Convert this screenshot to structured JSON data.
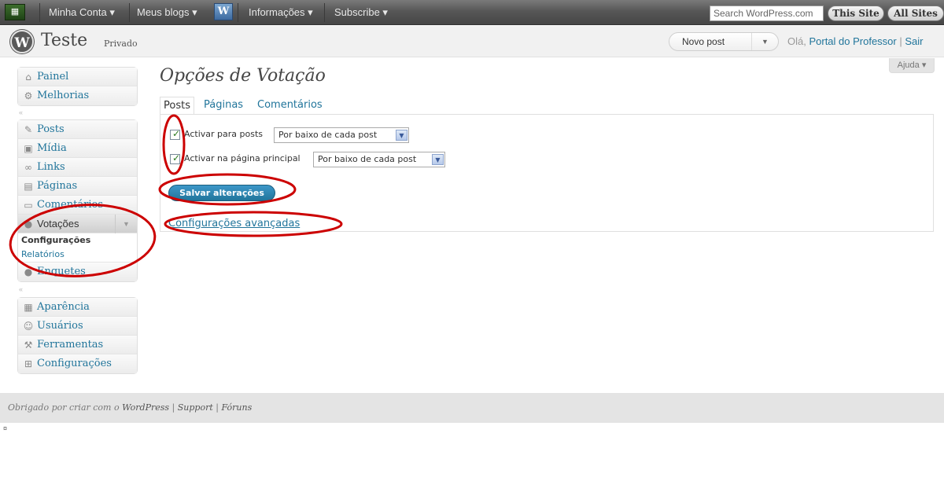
{
  "adminbar": {
    "logo_glyph": "▦",
    "my_account": "Minha Conta ▾",
    "my_blogs": "Meus blogs ▾",
    "info": "Informações ▾",
    "subscribe": "Subscribe ▾",
    "search_placeholder": "Search WordPress.com",
    "this_site": "This Site",
    "all_sites": "All Sites"
  },
  "header": {
    "site_title": "Teste",
    "site_privacy": "Privado",
    "new_post": "Novo post",
    "greeting_prefix": "Olá, ",
    "user_name": "Portal do Professor",
    "separator": " | ",
    "logout": "Sair",
    "help": "Ajuda ▾"
  },
  "sidebar": {
    "group1": [
      {
        "label": "Painel",
        "icon": "home-icon",
        "glyph": "⌂"
      },
      {
        "label": "Melhorias",
        "icon": "gear-icon",
        "glyph": "⚙"
      }
    ],
    "group2": [
      {
        "label": "Posts",
        "icon": "pin-icon",
        "glyph": "✎"
      },
      {
        "label": "Mídia",
        "icon": "media-icon",
        "glyph": "▣"
      },
      {
        "label": "Links",
        "icon": "link-icon",
        "glyph": "∞"
      },
      {
        "label": "Páginas",
        "icon": "pages-icon",
        "glyph": "▤"
      },
      {
        "label": "Comentários",
        "icon": "comment-icon",
        "glyph": "▭"
      }
    ],
    "active": {
      "label": "Votações",
      "icon": "polls-icon",
      "glyph": "●"
    },
    "submenu": [
      "Configurações",
      "Relatórios"
    ],
    "after_active": {
      "label": "Enquetes",
      "icon": "survey-icon",
      "glyph": "●"
    },
    "group3": [
      {
        "label": "Aparência",
        "icon": "appearance-icon",
        "glyph": "▦"
      },
      {
        "label": "Usuários",
        "icon": "users-icon",
        "glyph": "☺"
      },
      {
        "label": "Ferramentas",
        "icon": "tools-icon",
        "glyph": "⚒"
      },
      {
        "label": "Configurações",
        "icon": "settings-icon",
        "glyph": "⊞"
      }
    ]
  },
  "main": {
    "title": "Opções de Votação",
    "tabs": [
      "Posts",
      "Páginas",
      "Comentários"
    ],
    "options": [
      {
        "label": "Activar para posts",
        "checked": true,
        "select_value": "Por baixo de cada post"
      },
      {
        "label": "Activar na página principal",
        "checked": true,
        "select_value": "Por baixo de cada post"
      }
    ],
    "save_label": "Salvar alterações",
    "advanced_link": "Configurações avançadas"
  },
  "footer": {
    "prefix": "Obrigado por criar com o ",
    "wordpress": "WordPress",
    "sep1": " | ",
    "support": "Support",
    "sep2": " | ",
    "forums": "Fóruns"
  },
  "annotation_color": "#cc0000"
}
